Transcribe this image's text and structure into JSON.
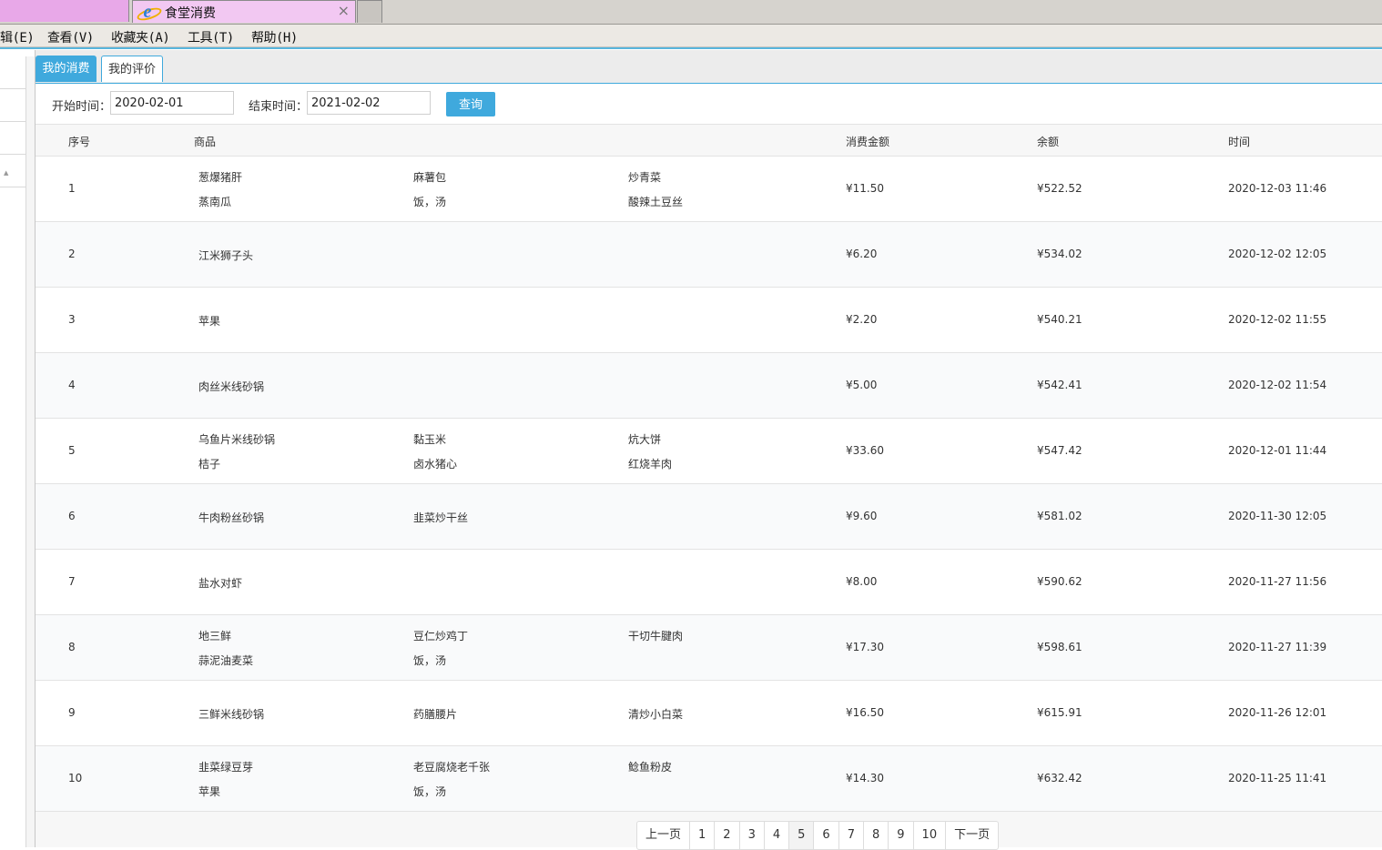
{
  "browser": {
    "tab_title": "食堂消费",
    "tab_close": "×",
    "menu": [
      "辑(E)",
      "查看(V)",
      "收藏夹(A)",
      "工具(T)",
      "帮助(H)"
    ]
  },
  "tabs": [
    {
      "label": "我的消费",
      "active": true
    },
    {
      "label": "我的评价",
      "active": false
    }
  ],
  "filter": {
    "start_label": "开始时间：",
    "start_value": "2020-02-01",
    "end_label": "结束时间：",
    "end_value": "2021-02-02",
    "query_button": "查询"
  },
  "table": {
    "headers": {
      "index": "序号",
      "goods": "商品",
      "amount": "消费金额",
      "balance": "余额",
      "time": "时间"
    },
    "rows": [
      {
        "index": "1",
        "goods": [
          "葱爆猪肝",
          "麻薯包",
          "炒青菜",
          "蒸南瓜",
          "饭，汤",
          "酸辣土豆丝"
        ],
        "amount": "¥11.50",
        "balance": "¥522.52",
        "time": "2020-12-03 11:46"
      },
      {
        "index": "2",
        "goods": [
          "江米狮子头"
        ],
        "amount": "¥6.20",
        "balance": "¥534.02",
        "time": "2020-12-02 12:05"
      },
      {
        "index": "3",
        "goods": [
          "苹果"
        ],
        "amount": "¥2.20",
        "balance": "¥540.21",
        "time": "2020-12-02 11:55"
      },
      {
        "index": "4",
        "goods": [
          "肉丝米线砂锅"
        ],
        "amount": "¥5.00",
        "balance": "¥542.41",
        "time": "2020-12-02 11:54"
      },
      {
        "index": "5",
        "goods": [
          "乌鱼片米线砂锅",
          "黏玉米",
          "炕大饼",
          "桔子",
          "卤水猪心",
          "红烧羊肉"
        ],
        "amount": "¥33.60",
        "balance": "¥547.42",
        "time": "2020-12-01 11:44"
      },
      {
        "index": "6",
        "goods": [
          "牛肉粉丝砂锅",
          "韭菜炒干丝"
        ],
        "amount": "¥9.60",
        "balance": "¥581.02",
        "time": "2020-11-30 12:05"
      },
      {
        "index": "7",
        "goods": [
          "盐水对虾"
        ],
        "amount": "¥8.00",
        "balance": "¥590.62",
        "time": "2020-11-27 11:56"
      },
      {
        "index": "8",
        "goods": [
          "地三鲜",
          "豆仁炒鸡丁",
          "干切牛腱肉",
          "蒜泥油麦菜",
          "饭，汤"
        ],
        "amount": "¥17.30",
        "balance": "¥598.61",
        "time": "2020-11-27 11:39"
      },
      {
        "index": "9",
        "goods": [
          "三鲜米线砂锅",
          "药膳腰片",
          "清炒小白菜"
        ],
        "amount": "¥16.50",
        "balance": "¥615.91",
        "time": "2020-11-26 12:01"
      },
      {
        "index": "10",
        "goods": [
          "韭菜绿豆芽",
          "老豆腐烧老千张",
          "鲶鱼粉皮",
          "苹果",
          "饭，汤"
        ],
        "amount": "¥14.30",
        "balance": "¥632.42",
        "time": "2020-11-25 11:41"
      }
    ]
  },
  "pagination": {
    "prev": "上一页",
    "pages": [
      "1",
      "2",
      "3",
      "4",
      "5",
      "6",
      "7",
      "8",
      "9",
      "10"
    ],
    "current": "5",
    "next": "下一页"
  },
  "colors": {
    "accent": "#3fa9dd",
    "tab_pink": "#f2c8f2"
  },
  "icons": {
    "browser_tab": "ie-icon",
    "left_strip": "caret-up-icon"
  }
}
